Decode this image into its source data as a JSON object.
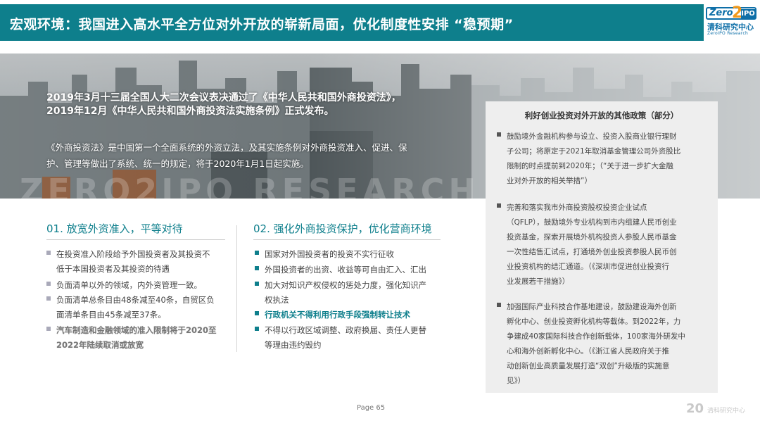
{
  "header": {
    "title": "宏观环境：我国进入高水平全方位对外开放的崭新局面，优化制度性安排 “稳预期”"
  },
  "logo": {
    "mark_left": "Zero",
    "mark_mid": "2",
    "mark_right": "IPO",
    "name_cn": "清科研究中心",
    "name_en": "ZeroIPO Research"
  },
  "hero": {
    "watermark": "ZERO2IPO RESEARCH",
    "line1": "2019年3月十三届全国人大二次会议表决通过了《中华人民共和国外商投资法》，",
    "line2": "2019年12月《中华人民共和国外商投资法实施条例》正式发布。",
    "line3": "《外商投资法》是中国第一个全面系统的外资立法，及其实施条例对外商投资准入、促进、保",
    "line4": "护、管理等做出了系统、统一的规定，将于2020年1月1日起实施。"
  },
  "panel": {
    "title": "利好创业投资对外开放的其他政策（部分）",
    "items": [
      {
        "lines": [
          "鼓励境外金融机构参与设立、投资入股商业银行理财",
          "子公司；将原定于2021年取消基金管理公司外资股比",
          "限制的时点提前到2020年；（“关于进一步扩大金融",
          "业对外开放的相关举措”）"
        ]
      },
      {
        "lines": [
          "完善和落实我市外商投资股权投资企业试点",
          "（QFLP），鼓励境外专业机构到市内组建人民币创业",
          "投资基金，探索开展境外机构投资人参股人民币基金",
          "一次性结售汇试点，打通境外创业投资参股人民币创",
          "业投资机构的结汇通道。（《深圳市促进创业投资行",
          "业发展若干措施》）"
        ]
      },
      {
        "lines": [
          "加强国际产业科技合作基地建设，鼓励建设海外创新",
          "孵化中心、创业投资孵化机构等载体。到2022年，力",
          "争建成40家国际科技合作创新载体，100家海外研发中",
          "心和海外创新孵化中心。（《浙江省人民政府关于推",
          "动创新创业高质量发展打造“双创”升级版的实施意",
          "见》）"
        ]
      }
    ]
  },
  "col1": {
    "num": "01.",
    "title": "放宽外资准入，平等对待",
    "items": [
      {
        "lines": [
          "在投资准入阶段给予外国投资者及其投资不",
          "低于本国投资者及其投资的待遇"
        ],
        "strong": false
      },
      {
        "lines": [
          "负面清单以外的领域，内外资管理一致。"
        ],
        "strong": false
      },
      {
        "lines": [
          "负面清单总条目由48条减至40条，自贸区负",
          "面清单条目由45条减至37条。"
        ],
        "strong": false
      },
      {
        "lines": [
          "汽车制造和金融领域的准入限制将于2020至",
          "2022年陆续取消或放宽"
        ],
        "strong": true
      }
    ]
  },
  "col2": {
    "num": "02.",
    "title": "强化外商投资保护，优化营商环境",
    "items": [
      {
        "lines": [
          "国家对外国投资者的投资不实行征收"
        ],
        "strong": false
      },
      {
        "lines": [
          "外国投资者的出资、收益等可自由汇入、汇出"
        ],
        "strong": false
      },
      {
        "lines": [
          "加大对知识产权侵权的惩处力度，强化知识产",
          "权执法"
        ],
        "strong": false
      },
      {
        "lines": [
          "行政机关不得利用行政手段强制转让技术"
        ],
        "strong": true
      },
      {
        "lines": [
          "不得以行政区域调整、政府换届、责任人更替",
          "等理由违约毁约"
        ],
        "strong": false
      }
    ]
  },
  "footer": {
    "page_label": "Page",
    "page_number": "65",
    "logo_num": "20",
    "logo_text": "清科研究中心"
  },
  "colors": {
    "accent": "#0e7f8c",
    "panel_bg": "#eeeeee",
    "bullet_grey": "#a9a9b9"
  }
}
